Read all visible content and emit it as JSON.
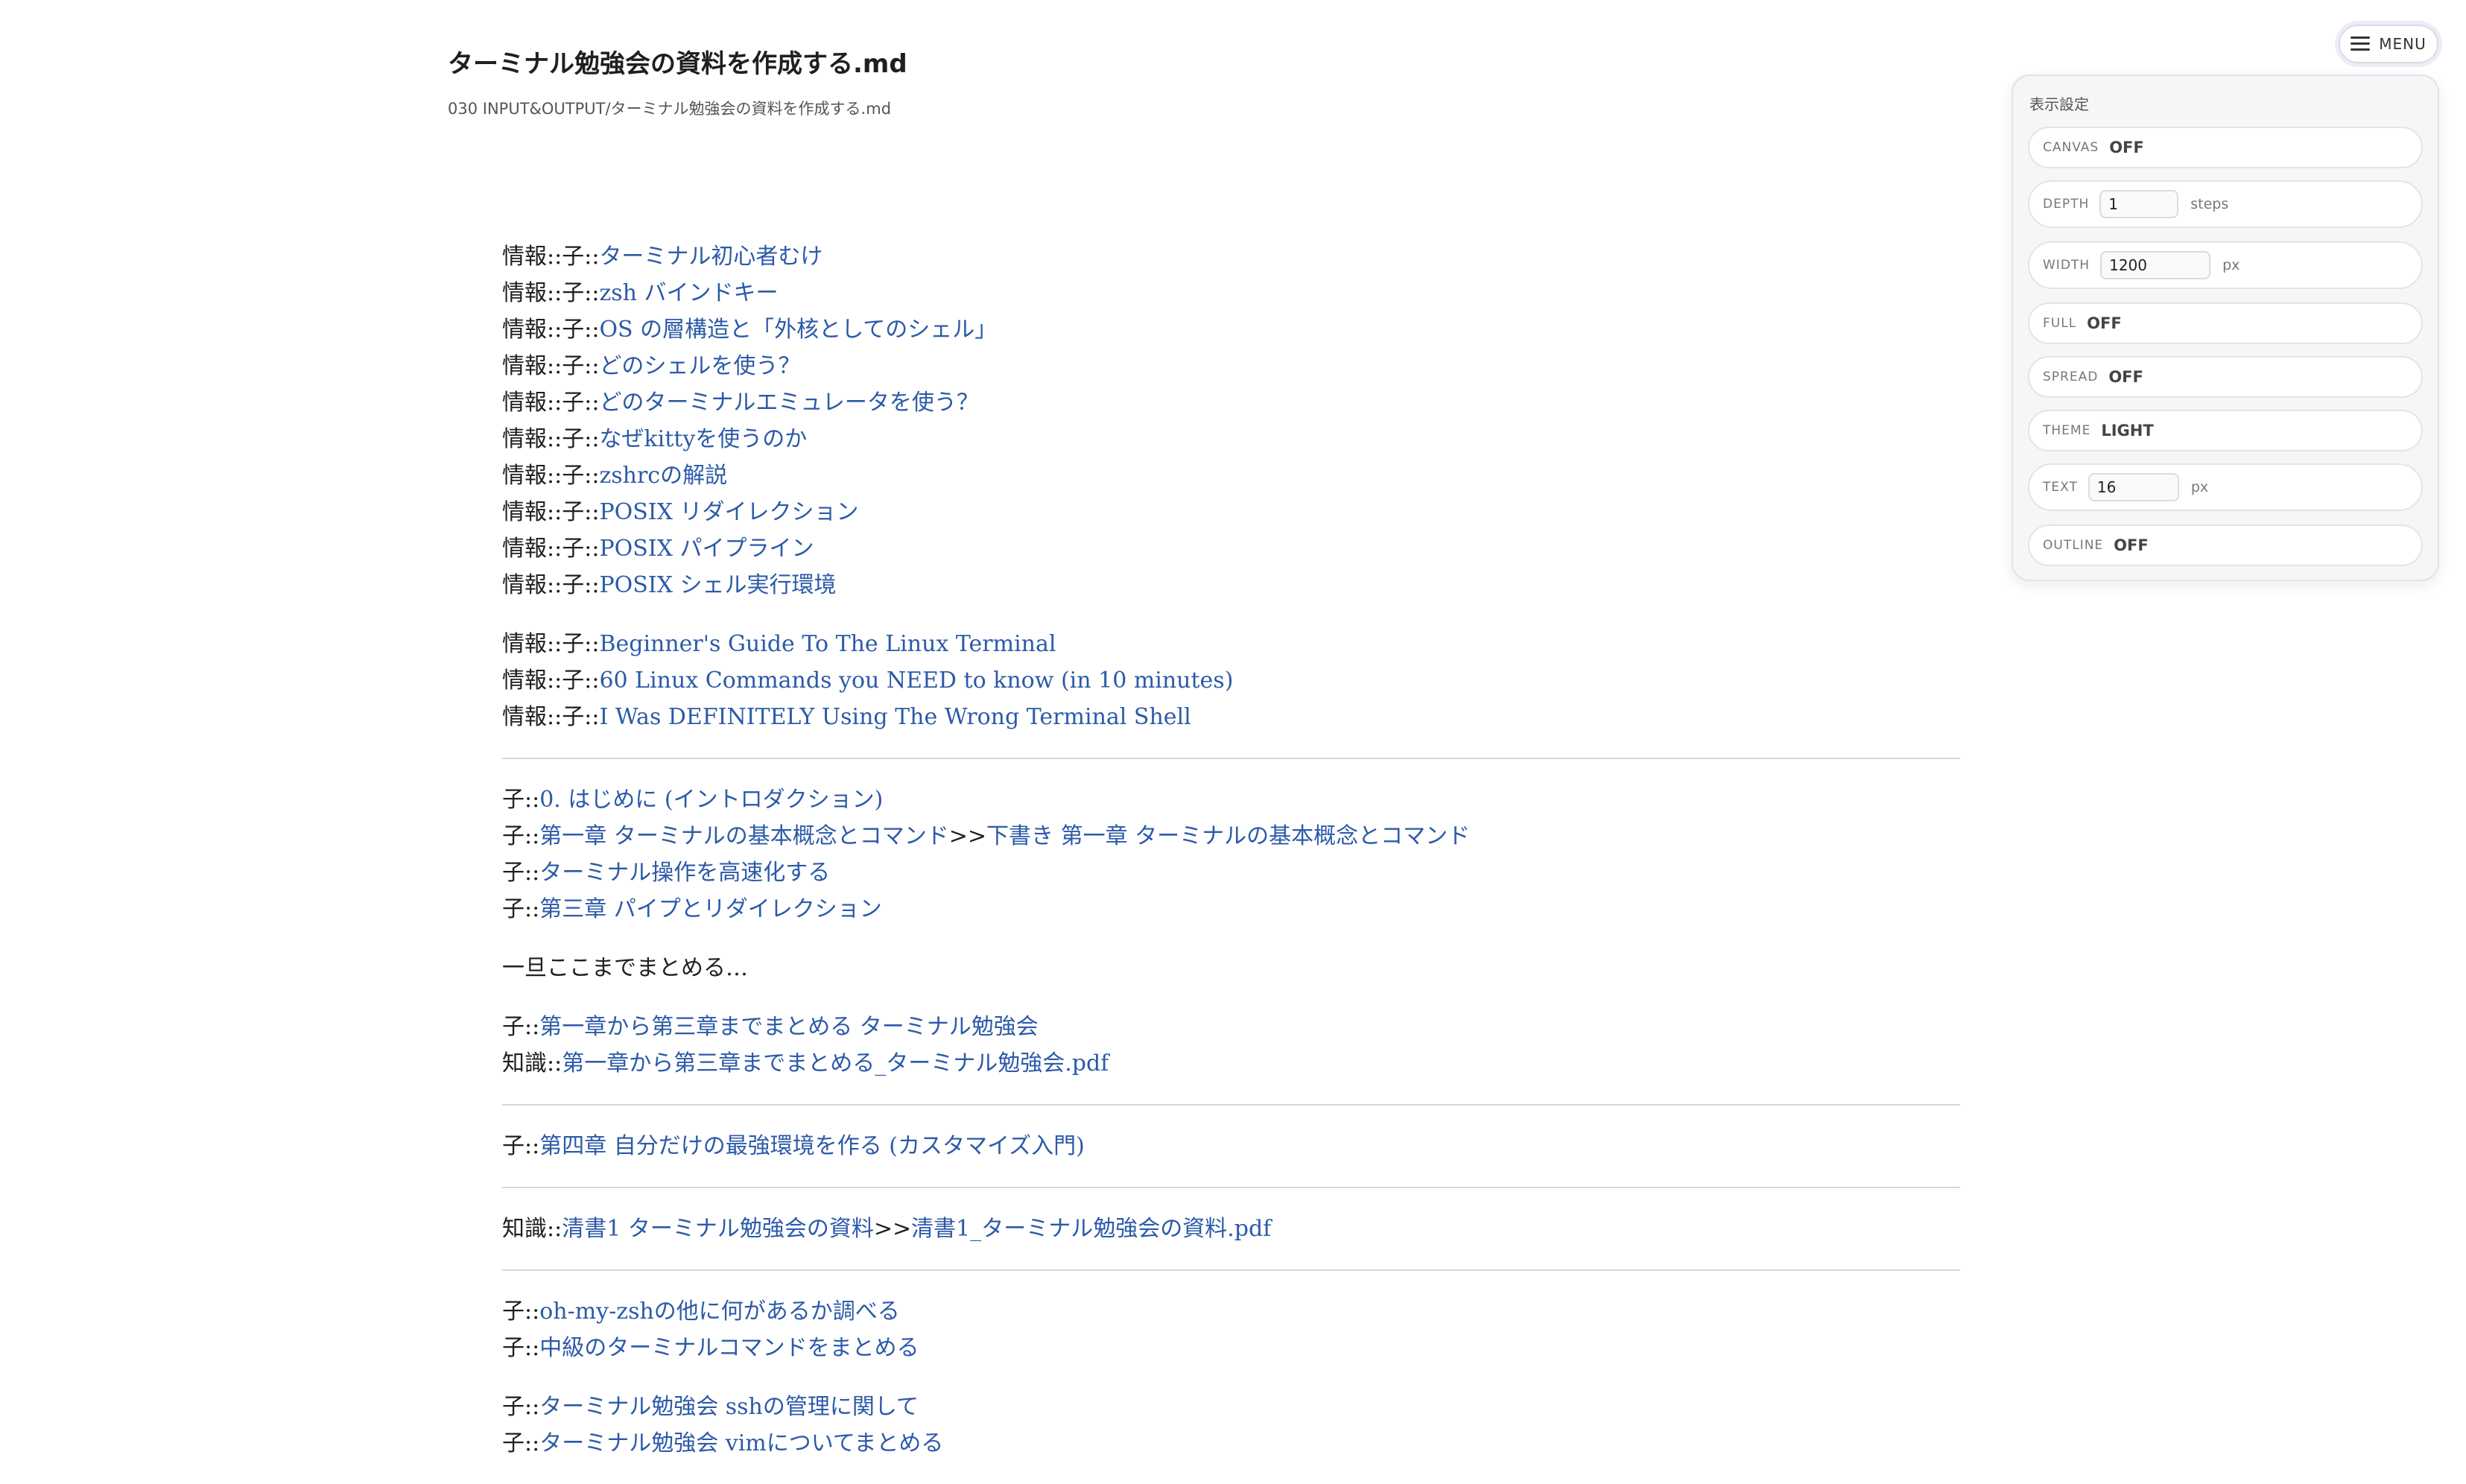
{
  "header": {
    "title": "ターミナル勉強会の資料を作成する.md",
    "path": "030 INPUT&OUTPUT/ターミナル勉強会の資料を作成する.md"
  },
  "menu": {
    "label": "MENU",
    "icon": "hamburger-icon"
  },
  "settings": {
    "title": "表示設定",
    "canvas": {
      "key": "CANVAS",
      "value": "OFF"
    },
    "depth": {
      "key": "DEPTH",
      "value": "1",
      "unit": "steps"
    },
    "width": {
      "key": "WIDTH",
      "value": "1200",
      "unit": "px"
    },
    "full": {
      "key": "FULL",
      "value": "OFF"
    },
    "spread": {
      "key": "SPREAD",
      "value": "OFF"
    },
    "theme": {
      "key": "THEME",
      "value": "LIGHT"
    },
    "text": {
      "key": "TEXT",
      "value": "16",
      "unit": "px"
    },
    "outline": {
      "key": "OUTLINE",
      "value": "OFF"
    }
  },
  "content": {
    "group1": [
      {
        "prefix": "情報::子::",
        "link": "ターミナル初心者むけ"
      },
      {
        "prefix": "情報::子::",
        "link": "zsh バインドキー"
      },
      {
        "prefix": "情報::子::",
        "link": "OS の層構造と「外核としてのシェル」"
      },
      {
        "prefix": "情報::子::",
        "link": "どのシェルを使う？"
      },
      {
        "prefix": "情報::子::",
        "link": "どのターミナルエミュレータを使う？"
      },
      {
        "prefix": "情報::子::",
        "link": "なぜkittyを使うのか"
      },
      {
        "prefix": "情報::子::",
        "link": "zshrcの解説"
      },
      {
        "prefix": "情報::子::",
        "link": "POSIX リダイレクション"
      },
      {
        "prefix": "情報::子::",
        "link": "POSIX パイプライン"
      },
      {
        "prefix": "情報::子::",
        "link": "POSIX シェル実行環境"
      }
    ],
    "group2": [
      {
        "prefix": "情報::子::",
        "link": "Beginner's Guide To The Linux Terminal"
      },
      {
        "prefix": "情報::子::",
        "link": "60 Linux Commands you NEED to know (in 10 minutes)"
      },
      {
        "prefix": "情報::子::",
        "link": "I Was DEFINITELY Using The Wrong Terminal Shell"
      }
    ],
    "group3": [
      {
        "prefix": "子::",
        "link": "0. はじめに (イントロダクション)"
      },
      {
        "prefix": "子::",
        "link": "第一章 ターミナルの基本概念とコマンド",
        "sep": ">>",
        "link2": "下書き 第一章 ターミナルの基本概念とコマンド"
      },
      {
        "prefix": "子::",
        "link": "ターミナル操作を高速化する"
      },
      {
        "prefix": "子::",
        "link": "第三章 パイプとリダイレクション"
      }
    ],
    "note": "一旦ここまでまとめる…",
    "group4": [
      {
        "prefix": "子::",
        "link": "第一章から第三章までまとめる ターミナル勉強会"
      },
      {
        "prefix": "知識::",
        "link": "第一章から第三章までまとめる_ターミナル勉強会.pdf"
      }
    ],
    "group5": [
      {
        "prefix": "子::",
        "link": "第四章 自分だけの最強環境を作る (カスタマイズ入門)"
      }
    ],
    "group6": [
      {
        "prefix": "知識::",
        "link": "清書1 ターミナル勉強会の資料",
        "sep": ">>",
        "link2": "清書1_ターミナル勉強会の資料.pdf"
      }
    ],
    "group7": [
      {
        "prefix": "子::",
        "link": "oh-my-zshの他に何があるか調べる"
      },
      {
        "prefix": "子::",
        "link": "中級のターミナルコマンドをまとめる"
      }
    ],
    "group8": [
      {
        "prefix": "子::",
        "link": "ターミナル勉強会 sshの管理に関して"
      },
      {
        "prefix": "子::",
        "link": "ターミナル勉強会 vimについてまとめる"
      }
    ]
  },
  "colors": {
    "link": "#2c5aa8",
    "text": "#1f1f1f",
    "rule": "#d6d6d6",
    "panel_bg": "#f6f6f7"
  }
}
